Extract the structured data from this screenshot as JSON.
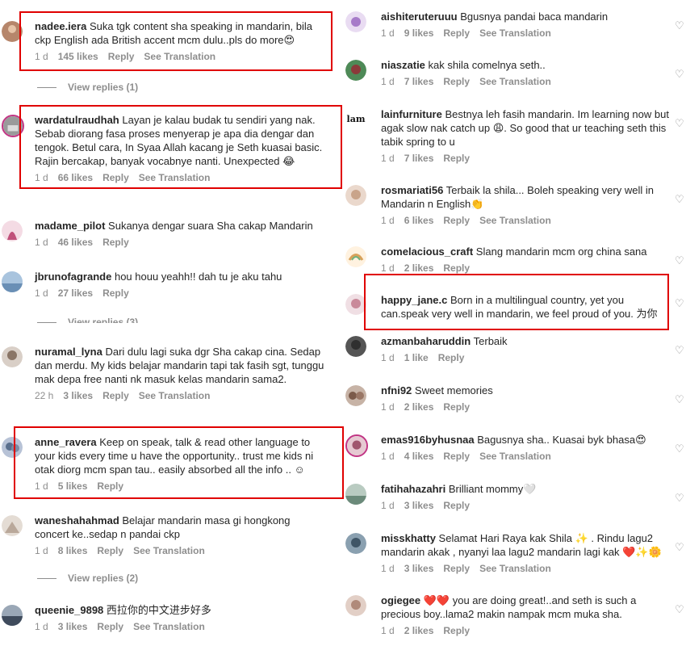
{
  "left": [
    {
      "user": "nadee.iera",
      "text": "Suka tgk content sha speaking in mandarin, bila ckp English ada British accent mcm dulu..pls do more😍",
      "time": "1 d",
      "likes": "145 likes",
      "reply": "Reply",
      "translate": "See Translation",
      "avatar_color": "#b6866b"
    },
    {
      "user": "wardatulraudhah",
      "text": "Layan je kalau budak tu sendiri yang nak. Sebab diorang fasa proses menyerap je apa dia dengar dan tengok. Betul cara, In Syaa Allah kacang je Seth kuasai basic. Rajin bercakap, banyak vocabnye nanti. Unexpected 😂",
      "time": "1 d",
      "likes": "66 likes",
      "reply": "Reply",
      "translate": "See Translation",
      "avatar_color": "#9a9a9a"
    },
    {
      "user": "madame_pilot",
      "text": "Sukanya dengar suara Sha cakap Mandarin",
      "time": "1 d",
      "likes": "46 likes",
      "reply": "Reply",
      "translate": "",
      "avatar_color": "#c0507a"
    },
    {
      "user": "jbrunofagrande",
      "text": "hou houu yeahh!! dah tu je aku tahu",
      "time": "1 d",
      "likes": "27 likes",
      "reply": "Reply",
      "translate": "",
      "avatar_color": "#6a8fb5"
    },
    {
      "user": "nuramal_lyna",
      "text": "Dari dulu lagi suka dgr Sha cakap cina. Sedap dan merdu. My kids belajar mandarin tapi tak fasih sgt, tunggu mak depa free nanti nk masuk kelas mandarin sama2.",
      "time": "22 h",
      "likes": "3 likes",
      "reply": "Reply",
      "translate": "See Translation",
      "avatar_color": "#8a7566"
    },
    {
      "user": "anne_ravera",
      "text": "Keep on speak, talk & read other language to your kids every time u have the opportunity.. trust me kids ni otak diorg mcm span tau.. easily absorbed all the info .. ☺",
      "time": "1 d",
      "likes": "5 likes",
      "reply": "Reply",
      "translate": "",
      "avatar_color": "#5a6f8d"
    },
    {
      "user": "waneshahahmad",
      "text": "Belajar mandarin masa gi hongkong concert ke..sedap n pandai ckp",
      "time": "1 d",
      "likes": "8 likes",
      "reply": "Reply",
      "translate": "See Translation",
      "avatar_color": "#b9a89a"
    },
    {
      "user": "queenie_9898",
      "text": "西拉你的中文进步好多",
      "time": "1 d",
      "likes": "3 likes",
      "reply": "Reply",
      "translate": "See Translation",
      "avatar_color": "#3f4b5c"
    }
  ],
  "left_view_replies": [
    "View replies (1)",
    "View replies (3)",
    "View replies (2)"
  ],
  "right": [
    {
      "user": "aishiteruteruuu",
      "text": "Bgusnya pandai baca mandarin",
      "time": "1 d",
      "likes": "9 likes",
      "reply": "Reply",
      "translate": "See Translation",
      "avatar_color": "#a77bc9"
    },
    {
      "user": "niaszatie",
      "text": "kak shila comelnya seth..",
      "time": "1 d",
      "likes": "7 likes",
      "reply": "Reply",
      "translate": "See Translation",
      "avatar_color": "#8b3a3a"
    },
    {
      "user": "lainfurniture",
      "text": "Bestnya leh fasih mandarin. Im learning now but agak slow nak catch up 😩. So good that ur teaching seth this tabik spring to u",
      "time": "1 d",
      "likes": "7 likes",
      "reply": "Reply",
      "translate": "",
      "avatar_label": "lam",
      "avatar_color": "#ffffff"
    },
    {
      "user": "rosmariati56",
      "text": "Terbaik la shila... Boleh speaking very well in Mandarin n English👏",
      "time": "1 d",
      "likes": "6 likes",
      "reply": "Reply",
      "translate": "See Translation",
      "avatar_color": "#c9a48a"
    },
    {
      "user": "comelacious_craft",
      "text": "Slang mandarin mcm org china sana",
      "time": "1 d",
      "likes": "2 likes",
      "reply": "Reply",
      "translate": "",
      "avatar_color": "#d8a15a"
    },
    {
      "user": "happy_jane.c",
      "text": "Born in a multilingual country, yet you can.speak very well in mandarin, we feel proud of you. 为你",
      "time": "",
      "likes": "",
      "reply": "",
      "translate": "",
      "avatar_color": "#c98a9a"
    },
    {
      "user": "azmanbaharuddin",
      "text": "Terbaik",
      "time": "1 d",
      "likes": "1 like",
      "reply": "Reply",
      "translate": "",
      "avatar_color": "#2f2f2f"
    },
    {
      "user": "nfni92",
      "text": "Sweet memories",
      "time": "1 d",
      "likes": "2 likes",
      "reply": "Reply",
      "translate": "",
      "avatar_color": "#7b5a4a"
    },
    {
      "user": "emas916byhusnaa",
      "text": "Bagusnya sha.. Kuasai byk bhasa😍",
      "time": "1 d",
      "likes": "4 likes",
      "reply": "Reply",
      "translate": "See Translation",
      "avatar_color": "#a0566e"
    },
    {
      "user": "fatihahazahri",
      "text": "Brilliant mommy🤍",
      "time": "1 d",
      "likes": "3 likes",
      "reply": "Reply",
      "translate": "",
      "avatar_color": "#6b8a7a"
    },
    {
      "user": "misskhatty",
      "text": "Selamat Hari Raya kak Shila ✨ . Rindu lagu2 mandarin akak , nyanyi laa lagu2 mandarin lagi kak ❤️✨🌼",
      "time": "1 d",
      "likes": "3 likes",
      "reply": "Reply",
      "translate": "See Translation",
      "avatar_color": "#3f5566"
    },
    {
      "user": "ogiegee",
      "text": "❤️❤️ you are doing great!..and seth is such a precious boy..lama2 makin nampak mcm muka sha.",
      "time": "1 d",
      "likes": "2 likes",
      "reply": "Reply",
      "translate": "",
      "avatar_color": "#b08a7a"
    }
  ],
  "icons": {
    "heart": "heart-icon",
    "highlight_color": "#e00000"
  }
}
